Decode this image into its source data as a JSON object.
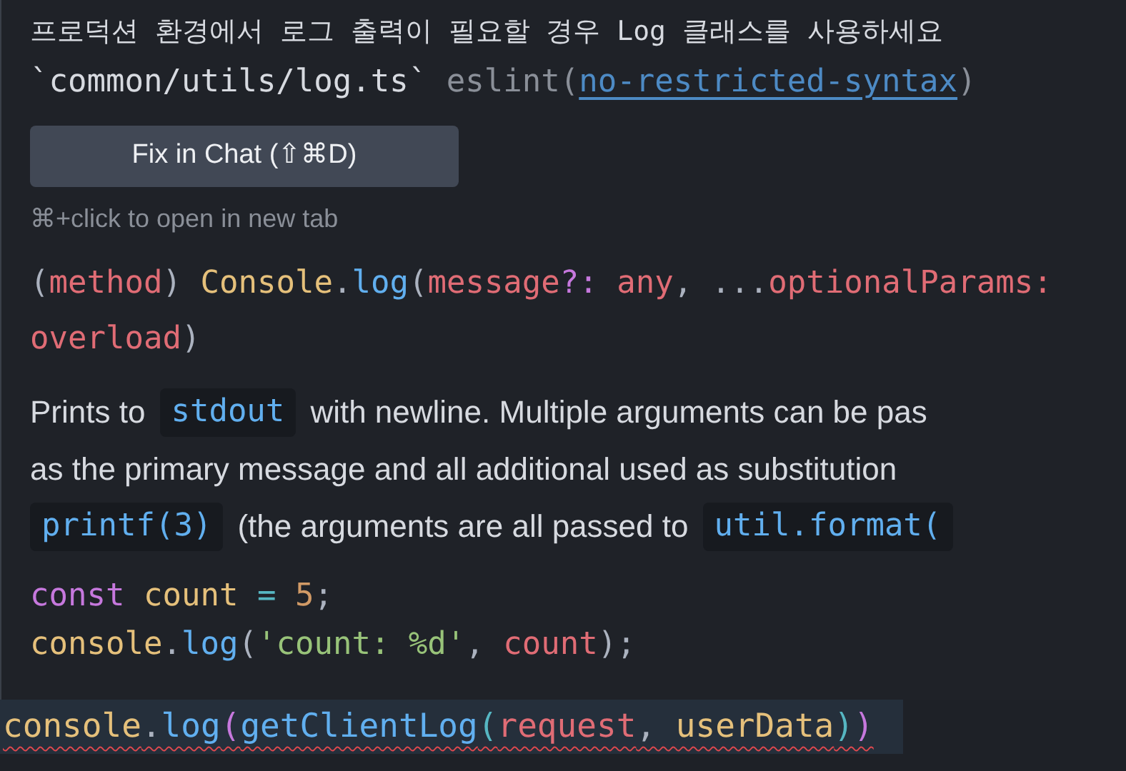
{
  "hover": {
    "message": "프로덕션 환경에서 로그 출력이 필요할 경우 Log 클래스를 사용하세요",
    "source_file": "`common/utils/log.ts`",
    "source": "eslint(",
    "rule_link": "no-restricted-syntax",
    "source_close": ")",
    "fix_button": "Fix in Chat (⇧⌘D)",
    "hint": "⌘+click to open in new tab",
    "signature": [
      [
        {
          "text": "(",
          "kind": "punct"
        },
        {
          "text": "method",
          "kind": "param"
        },
        {
          "text": ") ",
          "kind": "punct"
        },
        {
          "text": "Console",
          "kind": "type"
        },
        {
          "text": ".",
          "kind": "punct"
        },
        {
          "text": "log",
          "kind": "function"
        },
        {
          "text": "(",
          "kind": "punct"
        },
        {
          "text": "message",
          "kind": "param"
        },
        {
          "text": "?:",
          "kind": "operator"
        },
        {
          "text": " any",
          "kind": "param"
        },
        {
          "text": ", ...",
          "kind": "punct"
        },
        {
          "text": "optionalParams:",
          "kind": "param"
        }
      ],
      [
        {
          "text": "overload",
          "kind": "param"
        },
        {
          "text": ")",
          "kind": "punct"
        }
      ]
    ],
    "description": [
      [
        {
          "text": "Prints to",
          "kind": "text"
        },
        {
          "text": "stdout",
          "kind": "code"
        },
        {
          "text": "with newline. Multiple arguments can be pas",
          "kind": "text"
        }
      ],
      [
        {
          "text": "as the primary message and all additional used as substitution",
          "kind": "text"
        }
      ],
      [
        {
          "text": "printf(3)",
          "kind": "code"
        },
        {
          "text": "(the arguments are all passed to",
          "kind": "text"
        },
        {
          "text": "util.format(",
          "kind": "code"
        }
      ]
    ],
    "code_lines": [
      [
        {
          "text": "const",
          "kind": "keyword"
        },
        {
          "text": " count",
          "kind": "variable"
        },
        {
          "text": " = ",
          "kind": "operator2"
        },
        {
          "text": "5",
          "kind": "number"
        },
        {
          "text": ";",
          "kind": "punct"
        }
      ],
      [
        {
          "text": "console",
          "kind": "variable"
        },
        {
          "text": ".",
          "kind": "punct"
        },
        {
          "text": "log",
          "kind": "function"
        },
        {
          "text": "(",
          "kind": "punct"
        },
        {
          "text": "'count: %d'",
          "kind": "string"
        },
        {
          "text": ", ",
          "kind": "punct"
        },
        {
          "text": "count",
          "kind": "param"
        },
        {
          "text": ");",
          "kind": "punct"
        }
      ]
    ]
  },
  "editor_line": {
    "error": true,
    "tokens": [
      {
        "text": "console",
        "kind": "variable"
      },
      {
        "text": ".",
        "kind": "punct"
      },
      {
        "text": "log",
        "kind": "function"
      },
      {
        "text": "(",
        "kind": "bracket"
      },
      {
        "text": "getClientLog",
        "kind": "function"
      },
      {
        "text": "(",
        "kind": "bracket2"
      },
      {
        "text": "request",
        "kind": "param"
      },
      {
        "text": ", ",
        "kind": "punct"
      },
      {
        "text": "userData",
        "kind": "variable"
      },
      {
        "text": ")",
        "kind": "bracket2"
      },
      {
        "text": ")",
        "kind": "bracket"
      }
    ]
  }
}
